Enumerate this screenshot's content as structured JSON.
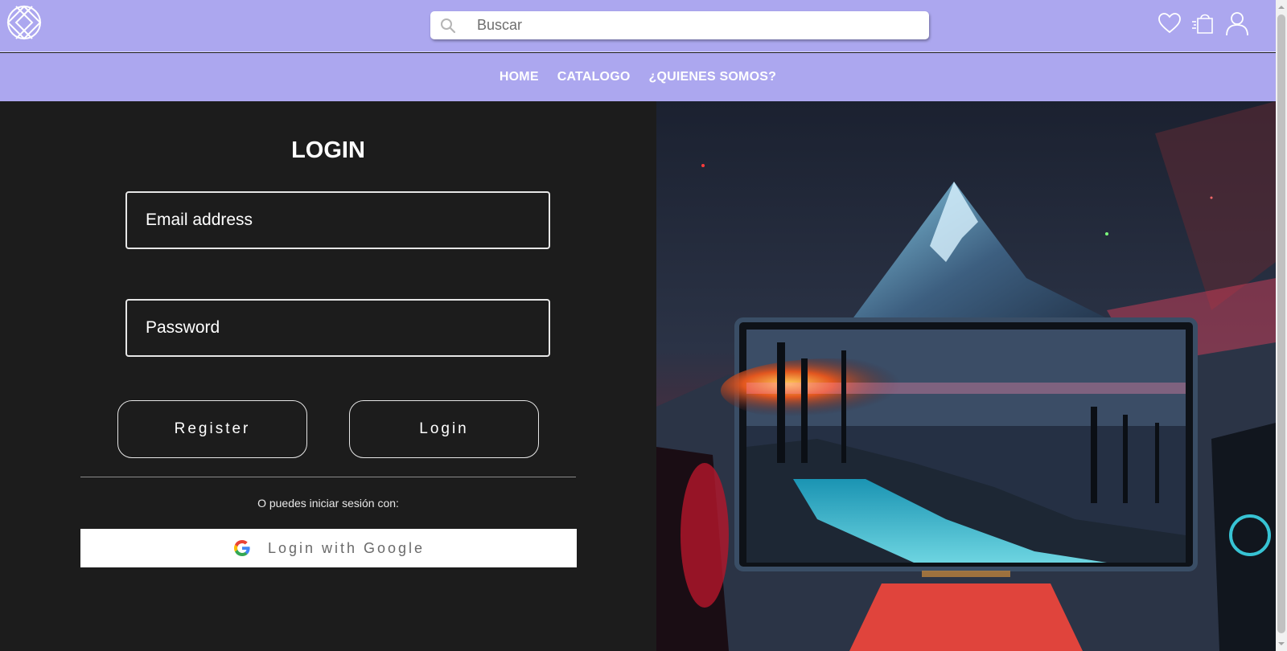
{
  "header": {
    "search_placeholder": "Buscar",
    "icons": [
      "logo-icon",
      "search-icon",
      "heart-icon",
      "shopping-bag-icon",
      "user-icon"
    ]
  },
  "nav": {
    "items": [
      {
        "label": "HOME"
      },
      {
        "label": "CATALOGO"
      },
      {
        "label": "¿QUIENES SOMOS?"
      }
    ]
  },
  "login": {
    "title": "LOGIN",
    "email_placeholder": "Email address",
    "password_placeholder": "Password",
    "register_label": "Register",
    "login_label": "Login",
    "alt_text": "O puedes iniciar sesión con:",
    "google_label": "Login with Google"
  },
  "colors": {
    "header_bg": "#aca7ef",
    "panel_bg": "#1c1c1c",
    "text": "#ffffff"
  }
}
